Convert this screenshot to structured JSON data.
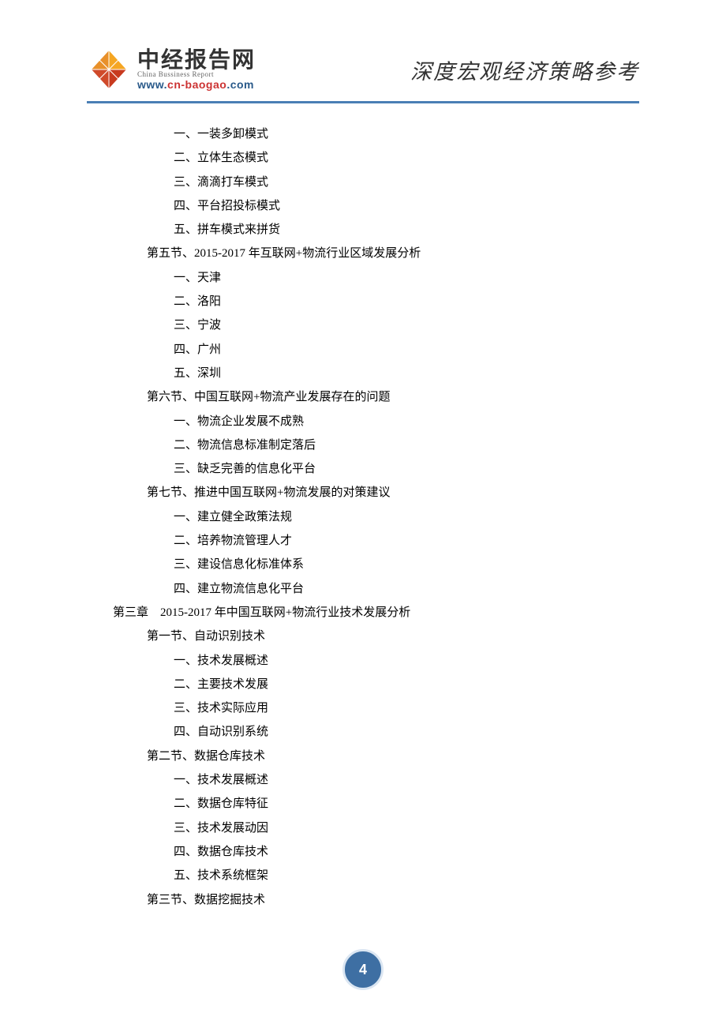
{
  "header": {
    "logo_title": "中经报告网",
    "logo_sub": "China Bussiness Report",
    "url_w": "www.",
    "url_cn": "cn-baogao",
    "url_rest": ".com",
    "tagline": "深度宏观经济策略参考"
  },
  "toc": [
    {
      "level": 3,
      "text": "一、一装多卸模式"
    },
    {
      "level": 3,
      "text": "二、立体生态模式"
    },
    {
      "level": 3,
      "text": "三、滴滴打车模式"
    },
    {
      "level": 3,
      "text": "四、平台招投标模式"
    },
    {
      "level": 3,
      "text": "五、拼车模式来拼货"
    },
    {
      "level": 2,
      "text": "第五节、2015-2017 年互联网+物流行业区域发展分析"
    },
    {
      "level": 3,
      "text": "一、天津"
    },
    {
      "level": 3,
      "text": "二、洛阳"
    },
    {
      "level": 3,
      "text": "三、宁波"
    },
    {
      "level": 3,
      "text": "四、广州"
    },
    {
      "level": 3,
      "text": "五、深圳"
    },
    {
      "level": 2,
      "text": "第六节、中国互联网+物流产业发展存在的问题"
    },
    {
      "level": 3,
      "text": "一、物流企业发展不成熟"
    },
    {
      "level": 3,
      "text": "二、物流信息标准制定落后"
    },
    {
      "level": 3,
      "text": "三、缺乏完善的信息化平台"
    },
    {
      "level": 2,
      "text": "第七节、推进中国互联网+物流发展的对策建议"
    },
    {
      "level": 3,
      "text": "一、建立健全政策法规"
    },
    {
      "level": 3,
      "text": "二、培养物流管理人才"
    },
    {
      "level": 3,
      "text": "三、建设信息化标准体系"
    },
    {
      "level": 3,
      "text": "四、建立物流信息化平台"
    },
    {
      "level": 1,
      "text": "第三章　2015-2017 年中国互联网+物流行业技术发展分析"
    },
    {
      "level": 2,
      "text": "第一节、自动识别技术"
    },
    {
      "level": 3,
      "text": "一、技术发展概述"
    },
    {
      "level": 3,
      "text": "二、主要技术发展"
    },
    {
      "level": 3,
      "text": "三、技术实际应用"
    },
    {
      "level": 3,
      "text": "四、自动识别系统"
    },
    {
      "level": 2,
      "text": "第二节、数据仓库技术"
    },
    {
      "level": 3,
      "text": "一、技术发展概述"
    },
    {
      "level": 3,
      "text": "二、数据仓库特征"
    },
    {
      "level": 3,
      "text": "三、技术发展动因"
    },
    {
      "level": 3,
      "text": "四、数据仓库技术"
    },
    {
      "level": 3,
      "text": "五、技术系统框架"
    },
    {
      "level": 2,
      "text": "第三节、数据挖掘技术"
    }
  ],
  "page_number": "4"
}
